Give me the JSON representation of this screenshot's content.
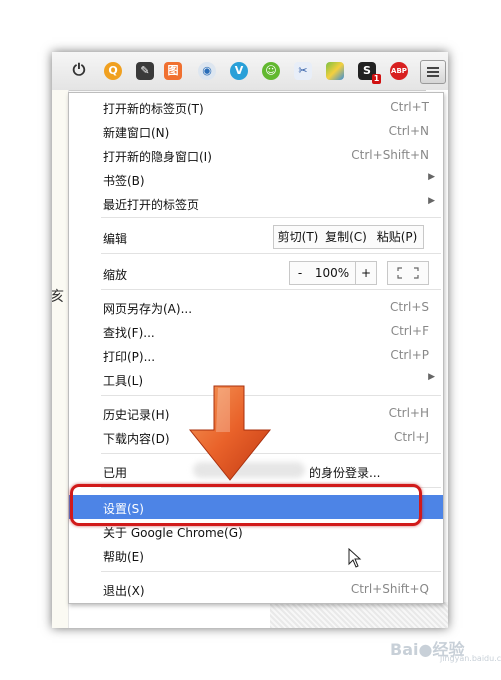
{
  "toolbar": {
    "icons": [
      "power-icon",
      "qzone-extension-icon",
      "evernote-extension-icon",
      "tuding-extension-icon",
      "record-extension-icon",
      "vimeo-extension-icon",
      "wechat-extension-icon",
      "screenshot-extension-icon",
      "google-maps-extension-icon",
      "stylebot-extension-icon",
      "adblock-plus-extension-icon"
    ],
    "stylebot_badge": "1",
    "adblock_label": "ABP",
    "menu_button": "chrome-menu-icon"
  },
  "left_page_glyph": "亥",
  "menu": {
    "new_tab": {
      "label": "打开新的标签页(T)",
      "shortcut": "Ctrl+T"
    },
    "new_window": {
      "label": "新建窗口(N)",
      "shortcut": "Ctrl+N"
    },
    "incognito": {
      "label": "打开新的隐身窗口(I)",
      "shortcut": "Ctrl+Shift+N"
    },
    "bookmarks": {
      "label": "书签(B)"
    },
    "recent_tabs": {
      "label": "最近打开的标签页"
    },
    "edit": {
      "label": "编辑",
      "cut": "剪切(T)",
      "copy": "复制(C)",
      "paste": "粘贴(P)"
    },
    "zoom": {
      "label": "缩放",
      "minus": "-",
      "value": "100%",
      "plus": "+"
    },
    "save_as": {
      "label": "网页另存为(A)...",
      "shortcut": "Ctrl+S"
    },
    "find": {
      "label": "查找(F)...",
      "shortcut": "Ctrl+F"
    },
    "print": {
      "label": "打印(P)...",
      "shortcut": "Ctrl+P"
    },
    "tools": {
      "label": "工具(L)"
    },
    "history": {
      "label": "历史记录(H)",
      "shortcut": "Ctrl+H"
    },
    "downloads": {
      "label": "下载内容(D)",
      "shortcut": "Ctrl+J"
    },
    "signed_in": {
      "prefix": "已用",
      "suffix": "的身份登录..."
    },
    "settings": {
      "label": "设置(S)"
    },
    "about": {
      "label": "关于 Google Chrome(G)"
    },
    "help": {
      "label": "帮助(E)"
    },
    "exit": {
      "label": "退出(X)",
      "shortcut": "Ctrl+Shift+Q"
    }
  },
  "annotation": {
    "arrow_color": "#e2531f",
    "highlight_color": "#d11a1a"
  },
  "watermark": {
    "text": "Bai",
    "suffix": "经验",
    "sub": "jingyan.baidu.com"
  },
  "colors": {
    "selected": "#4d84e6"
  }
}
